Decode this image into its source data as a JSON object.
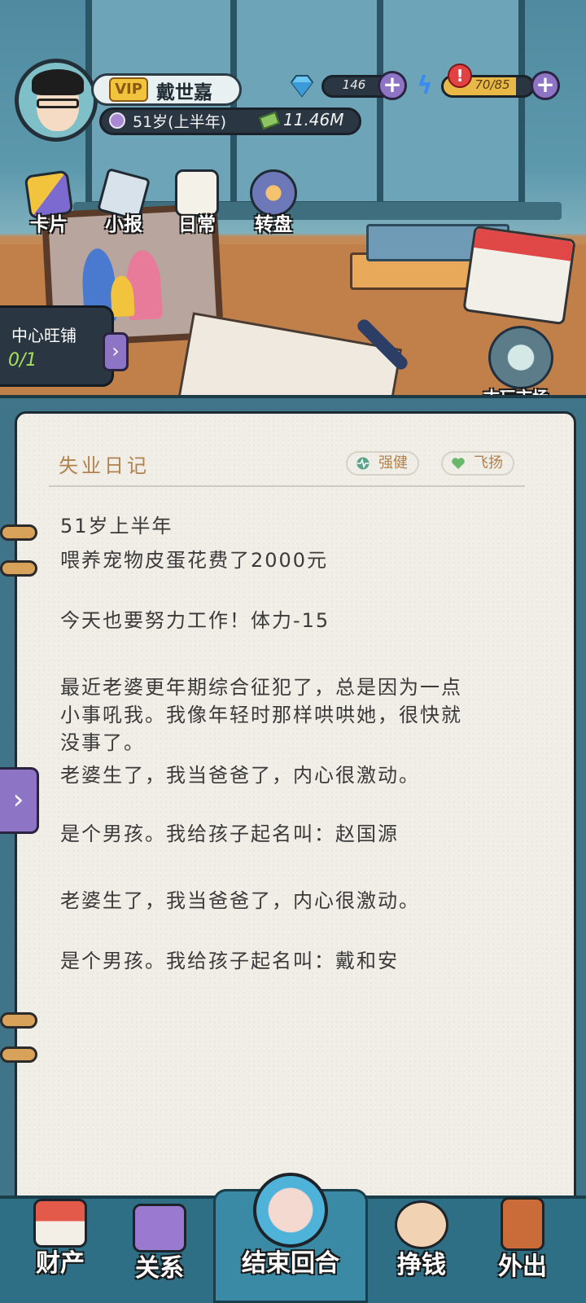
{
  "header": {
    "vip_label": "VIP",
    "player_name": "戴世嘉",
    "age_label": "51岁(上半年)",
    "money": "11.46M",
    "diamonds": "146",
    "energy": "70/85",
    "energy_fraction": 0.82
  },
  "quick_actions": [
    {
      "label": "卡片"
    },
    {
      "label": "小报"
    },
    {
      "label": "日常"
    },
    {
      "label": "转盘"
    }
  ],
  "shop": {
    "title": "中心旺铺",
    "progress": "0/1"
  },
  "antique_market": {
    "label": "古玩市场"
  },
  "notebook": {
    "title": "失业日记",
    "tags": [
      {
        "label": "强健"
      },
      {
        "label": "飞扬"
      }
    ],
    "lines": [
      "51岁上半年",
      "喂养宠物皮蛋花费了2000元",
      "今天也要努力工作！体力-15",
      "最近老婆更年期综合征犯了，总是因为一点",
      "小事吼我。我像年轻时那样哄哄她，很快就",
      "没事了。",
      "老婆生了，我当爸爸了，内心很激动。",
      "是个男孩。我给孩子起名叫：赵国源",
      "老婆生了，我当爸爸了，内心很激动。",
      "是个男孩。我给孩子起名叫：戴和安"
    ]
  },
  "bottom_nav": [
    {
      "label": "财产"
    },
    {
      "label": "关系"
    },
    {
      "label": "结束回合"
    },
    {
      "label": "挣钱"
    },
    {
      "label": "外出"
    }
  ],
  "colors": {
    "accent_purple": "#8d74c4",
    "diary_title": "#b0824e",
    "energy": "#e9b948"
  }
}
